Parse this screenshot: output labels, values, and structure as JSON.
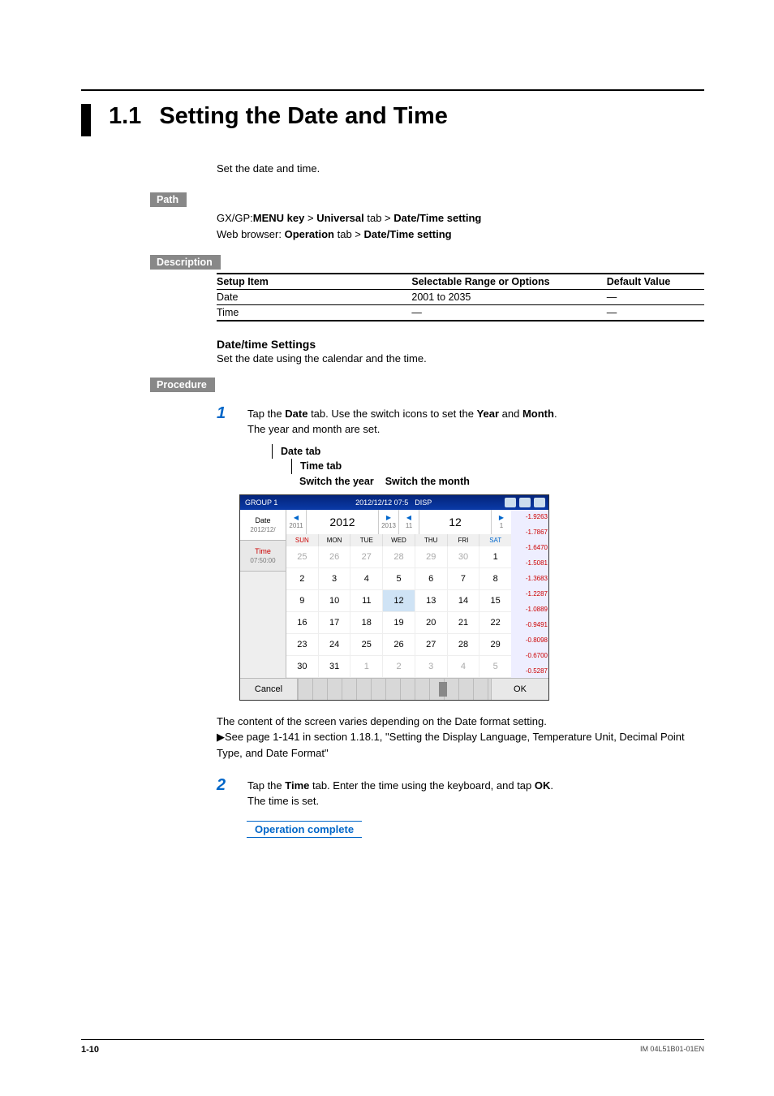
{
  "section_number": "1.1",
  "section_title": "Setting the Date and Time",
  "intro": "Set the date and time.",
  "labels": {
    "path": "Path",
    "description": "Description",
    "procedure": "Procedure"
  },
  "path": {
    "line1_prefix": "GX/GP:",
    "line1_k1": "MENU key",
    "line1_sep": " > ",
    "line1_k2": "Universal",
    "line1_tab": " tab > ",
    "line1_k3": "Date/Time setting",
    "line2_prefix": "Web browser: ",
    "line2_k1": "Operation",
    "line2_tab": " tab > ",
    "line2_k2": "Date/Time setting"
  },
  "table": {
    "h1": "Setup Item",
    "h2": "Selectable Range or Options",
    "h3": "Default Value",
    "rows": [
      {
        "c1": "Date",
        "c2": "2001 to 2035",
        "c3": "—"
      },
      {
        "c1": "Time",
        "c2": "—",
        "c3": "—"
      }
    ]
  },
  "subheading": "Date/time Settings",
  "subbody": "Set the date using the calendar and the time.",
  "step1": {
    "num": "1",
    "pre": "Tap the ",
    "b1": "Date",
    "mid1": " tab. Use the switch icons to set the ",
    "b2": "Year",
    "mid2": " and ",
    "b3": "Month",
    "post": ".",
    "line2": "The year and month are set."
  },
  "fig_labels": {
    "l1": "Date tab",
    "l2": "Time tab",
    "l3a": "Switch the year",
    "l3b": "Switch the month"
  },
  "screenshot": {
    "group": "GROUP 1",
    "topdate": "2012/12/12 07:5",
    "disp": "DISP",
    "tab_date": "Date",
    "tab_date_sub": "2012/12/",
    "tab_time": "Time",
    "tab_time_sub": "07:50:00",
    "year_prev": "2011",
    "year": "2012",
    "year_next": "2013",
    "month_prev": "11",
    "month": "12",
    "month_next": "1",
    "dow": [
      "SUN",
      "MON",
      "TUE",
      "WED",
      "THU",
      "FRI",
      "SAT"
    ],
    "cal_rows": [
      [
        "25",
        "26",
        "27",
        "28",
        "29",
        "30",
        "1"
      ],
      [
        "2",
        "3",
        "4",
        "5",
        "6",
        "7",
        "8"
      ],
      [
        "9",
        "10",
        "11",
        "12",
        "13",
        "14",
        "15"
      ],
      [
        "16",
        "17",
        "18",
        "19",
        "20",
        "21",
        "22"
      ],
      [
        "23",
        "24",
        "25",
        "26",
        "27",
        "28",
        "29"
      ],
      [
        "30",
        "31",
        "1",
        "2",
        "3",
        "4",
        "5"
      ]
    ],
    "sel_row": 2,
    "sel_col": 3,
    "off_cells": [
      [
        0,
        0
      ],
      [
        0,
        1
      ],
      [
        0,
        2
      ],
      [
        0,
        3
      ],
      [
        0,
        4
      ],
      [
        0,
        5
      ],
      [
        5,
        2
      ],
      [
        5,
        3
      ],
      [
        5,
        4
      ],
      [
        5,
        5
      ],
      [
        5,
        6
      ]
    ],
    "right_vals": [
      "-1.9263",
      "-1.7867",
      "-1.6470",
      "-1.5081",
      "-1.3683",
      "-1.2287",
      "-1.0889",
      "-0.9491",
      "-0.8098",
      "-0.6700",
      "-0.5287"
    ],
    "cancel": "Cancel",
    "ok": "OK"
  },
  "after_fig": {
    "line1": "The content of the screen varies depending on the Date format setting.",
    "line2": "See page 1-141 in section 1.18.1, \"Setting the Display Language, Temperature Unit, Decimal Point Type, and Date Format\""
  },
  "step2": {
    "num": "2",
    "pre": "Tap the ",
    "b1": "Time",
    "mid": " tab. Enter the time using the keyboard, and tap ",
    "b2": "OK",
    "post": ".",
    "line2": "The time is set."
  },
  "op_complete": "Operation complete",
  "footer": {
    "page": "1-10",
    "doc": "IM 04L51B01-01EN"
  }
}
